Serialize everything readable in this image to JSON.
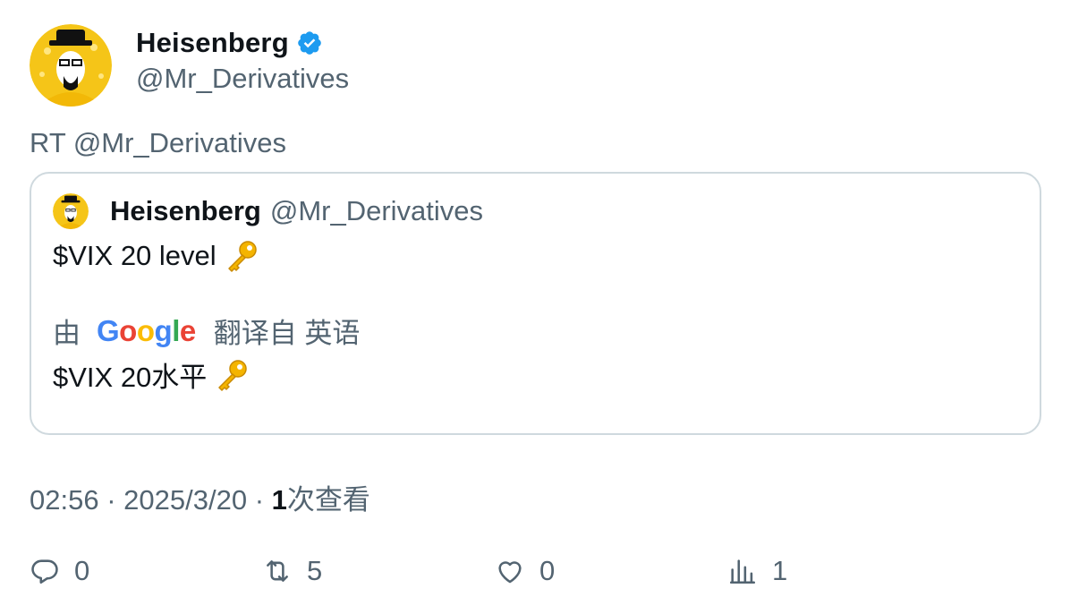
{
  "author": {
    "display_name": "Heisenberg",
    "handle": "@Mr_Derivatives",
    "verified_icon": "verified-badge-icon"
  },
  "retweet_line": "RT @Mr_Derivatives",
  "quote": {
    "display_name": "Heisenberg",
    "handle": "@Mr_Derivatives",
    "text": "$VIX 20 level",
    "translation_prefix": "由",
    "translation_provider": "Google",
    "translation_suffix": "翻译自 英语",
    "translated_text": "$VIX 20水平",
    "emoji_icon": "key-icon"
  },
  "meta": {
    "time": "02:56",
    "separator1": "·",
    "date": "2025/3/20",
    "separator2": "·",
    "views_count": "1",
    "views_label": "次查看"
  },
  "actions": {
    "replies": "0",
    "retweets": "5",
    "likes": "0",
    "views": "1"
  },
  "colors": {
    "primary_text": "#0f1419",
    "secondary_text": "#536471",
    "border": "#cfd9de",
    "verified": "#1d9bf0"
  }
}
